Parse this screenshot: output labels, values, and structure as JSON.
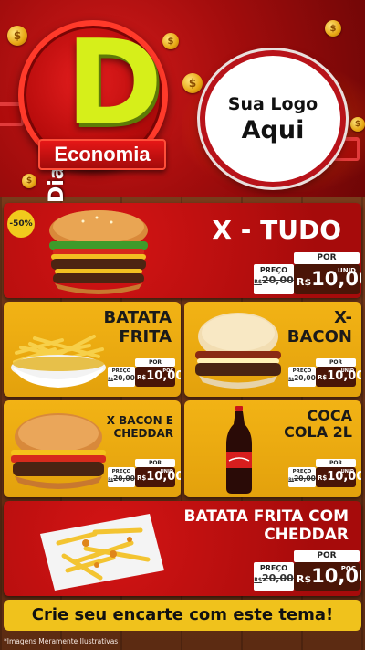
{
  "header": {
    "logo_small": "Dia",
    "logo_big": "D",
    "logo_banner": "Economia",
    "your_logo_line1": "Sua Logo",
    "your_logo_line2": "Aqui",
    "coin_symbol": "$"
  },
  "discount_badge": "-50%",
  "products": {
    "xtudo": {
      "name": "X - TUDO",
      "por": "POR",
      "preco": "PREÇO",
      "old": "20,00",
      "old_prefix": "R$",
      "currency": "R$",
      "price": "10,00",
      "unit": "UNID"
    },
    "batata": {
      "name_line1": "BATATA",
      "name_line2": "FRITA",
      "por": "POR",
      "preco": "PREÇO",
      "old": "20,00",
      "old_prefix": "R$",
      "currency": "R$",
      "price": "10,00",
      "unit": "POÇ"
    },
    "xbacon": {
      "name_line1": "X-",
      "name_line2": "BACON",
      "por": "POR",
      "preco": "PREÇO",
      "old": "20,00",
      "old_prefix": "R$",
      "currency": "R$",
      "price": "10,00",
      "unit": "UNID"
    },
    "xbacon_cheddar": {
      "name_line1": "X BACON E",
      "name_line2": "CHEDDAR",
      "por": "POR",
      "preco": "PREÇO",
      "old": "20,00",
      "old_prefix": "R$",
      "currency": "R$",
      "price": "10,00",
      "unit": "UNID"
    },
    "coca": {
      "name_line1": "COCA",
      "name_line2": "COLA 2L",
      "por": "POR",
      "preco": "PREÇO",
      "old": "20,00",
      "old_prefix": "R$",
      "currency": "R$",
      "price": "10,00",
      "unit": "UNID"
    },
    "batata_cheddar": {
      "name_line1": "BATATA FRITA COM",
      "name_line2": "CHEDDAR",
      "por": "POR",
      "preco": "PREÇO",
      "old": "20,00",
      "old_prefix": "R$",
      "currency": "R$",
      "price": "10,00",
      "unit": "POÇ"
    }
  },
  "cta": "Crie seu encarte com este tema!",
  "footnote": "*Imagens Meramente Ilustrativas",
  "colors": {
    "red": "#c40f0f",
    "yellow": "#f0b414",
    "dark_brown": "#4a1507",
    "lime": "#d6ef1a"
  }
}
